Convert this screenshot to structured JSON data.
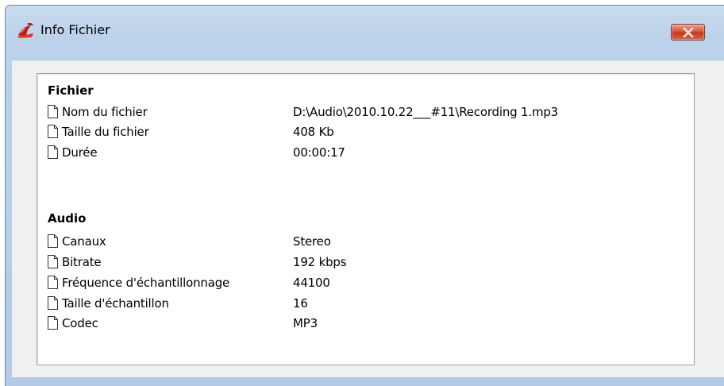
{
  "window": {
    "title": "Info Fichier",
    "app_icon": "app-logo-icon",
    "close_icon": "close-icon"
  },
  "sections": [
    {
      "title": "Fichier",
      "rows": [
        {
          "label": "Nom du fichier",
          "value": "D:\\Audio\\2010.10.22___#11\\Recording 1.mp3"
        },
        {
          "label": "Taille du fichier",
          "value": "408 Kb"
        },
        {
          "label": "Durée",
          "value": "00:00:17"
        }
      ]
    },
    {
      "title": "Audio",
      "rows": [
        {
          "label": "Canaux",
          "value": "Stereo"
        },
        {
          "label": "Bitrate",
          "value": "192 kbps"
        },
        {
          "label": "Fréquence d'échantillonnage",
          "value": "44100"
        },
        {
          "label": "Taille d'échantillon",
          "value": "16"
        },
        {
          "label": "Codec",
          "value": "MP3"
        }
      ]
    }
  ],
  "row_icon": "document-icon",
  "colors": {
    "titlebar": "#bcd2ea",
    "close_button": "#c7361c",
    "client_bg": "#f0f0f0",
    "panel_bg": "#ffffff"
  }
}
